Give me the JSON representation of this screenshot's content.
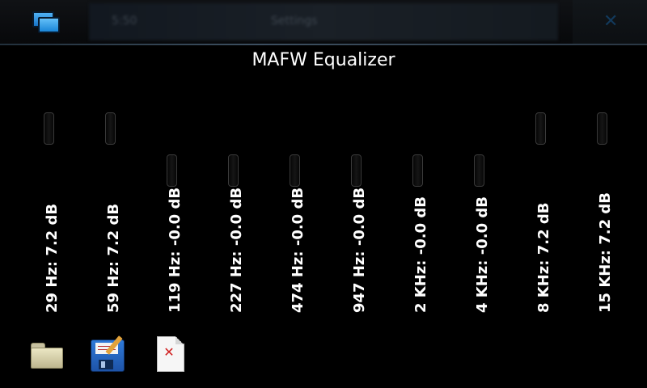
{
  "window": {
    "title": "MAFW Equalizer",
    "status_menu_label": "Settings",
    "status_clock": "5:50"
  },
  "bands": [
    {
      "label": "29 Hz: 7.2 dB",
      "freq": "29 Hz",
      "gain_db": 7.2
    },
    {
      "label": "59 Hz: 7.2 dB",
      "freq": "59 Hz",
      "gain_db": 7.2
    },
    {
      "label": "119 Hz: -0.0 dB",
      "freq": "119 Hz",
      "gain_db": -0.0
    },
    {
      "label": "227 Hz: -0.0 dB",
      "freq": "227 Hz",
      "gain_db": -0.0
    },
    {
      "label": "474 Hz: -0.0 dB",
      "freq": "474 Hz",
      "gain_db": -0.0
    },
    {
      "label": "947 Hz: -0.0 dB",
      "freq": "947 Hz",
      "gain_db": -0.0
    },
    {
      "label": "2 KHz: -0.0 dB",
      "freq": "2 KHz",
      "gain_db": -0.0
    },
    {
      "label": "4 KHz: -0.0 dB",
      "freq": "4 KHz",
      "gain_db": -0.0
    },
    {
      "label": "8 KHz: 7.2 dB",
      "freq": "8 KHz",
      "gain_db": 7.2
    },
    {
      "label": "15 KHz: 7.2 dB",
      "freq": "15 KHz",
      "gain_db": 7.2
    }
  ],
  "toolbar": {
    "open": {
      "icon": "folder-icon"
    },
    "save": {
      "icon": "floppy-save-icon"
    },
    "delete": {
      "icon": "delete-file-icon"
    }
  },
  "colors": {
    "background": "#000000",
    "text": "#ffffff",
    "accent": "#1f86d8"
  }
}
